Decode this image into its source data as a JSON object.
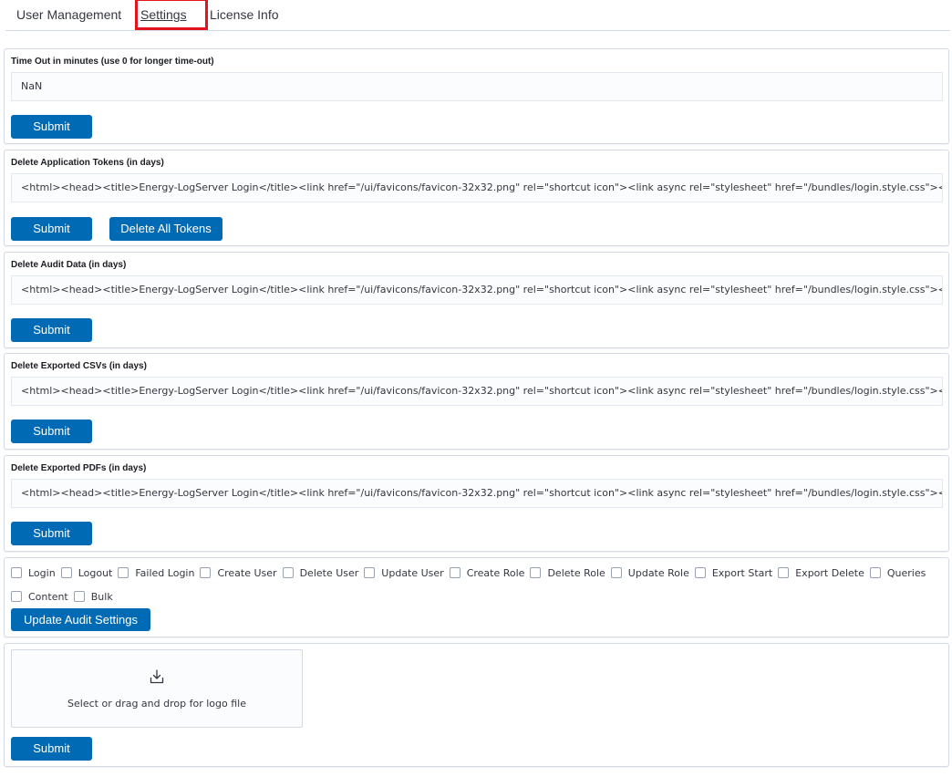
{
  "tabs": [
    {
      "label": "User Management"
    },
    {
      "label": "Settings"
    },
    {
      "label": "License Info"
    }
  ],
  "timeout": {
    "label": "Time Out in minutes (use 0 for longer time-out)",
    "value": "NaN",
    "submit": "Submit"
  },
  "tokens": {
    "label": "Delete Application Tokens (in days)",
    "value": "<html><head><title>Energy-LogServer Login</title><link href=\"/ui/favicons/favicon-32x32.png\" rel=\"shortcut icon\"><link async rel=\"stylesheet\" href=\"/bundles/login.style.css\"></head><body>",
    "submit": "Submit",
    "delete_all": "Delete All Tokens"
  },
  "audit": {
    "label": "Delete Audit Data (in days)",
    "value": "<html><head><title>Energy-LogServer Login</title><link href=\"/ui/favicons/favicon-32x32.png\" rel=\"shortcut icon\"><link async rel=\"stylesheet\" href=\"/bundles/login.style.css\"></head><body>",
    "submit": "Submit"
  },
  "csvs": {
    "label": "Delete Exported CSVs (in days)",
    "value": "<html><head><title>Energy-LogServer Login</title><link href=\"/ui/favicons/favicon-32x32.png\" rel=\"shortcut icon\"><link async rel=\"stylesheet\" href=\"/bundles/login.style.css\"></head><body>",
    "submit": "Submit"
  },
  "pdfs": {
    "label": "Delete Exported PDFs (in days)",
    "value": "<html><head><title>Energy-LogServer Login</title><link href=\"/ui/favicons/favicon-32x32.png\" rel=\"shortcut icon\"><link async rel=\"stylesheet\" href=\"/bundles/login.style.css\"></head><body>",
    "submit": "Submit"
  },
  "audit_settings": {
    "row1": [
      "Login",
      "Logout",
      "Failed Login",
      "Create User",
      "Delete User",
      "Update User",
      "Create Role",
      "Delete Role",
      "Update Role",
      "Export Start",
      "Export Delete",
      "Queries"
    ],
    "row2": [
      "Content",
      "Bulk"
    ],
    "update": "Update Audit Settings"
  },
  "logo": {
    "drop_text": "Select or drag and drop for logo file",
    "icon": "download-tray-icon",
    "submit": "Submit"
  },
  "colors": {
    "primary": "#006bb4",
    "highlight": "#e4141e",
    "border": "#d3dae6"
  }
}
